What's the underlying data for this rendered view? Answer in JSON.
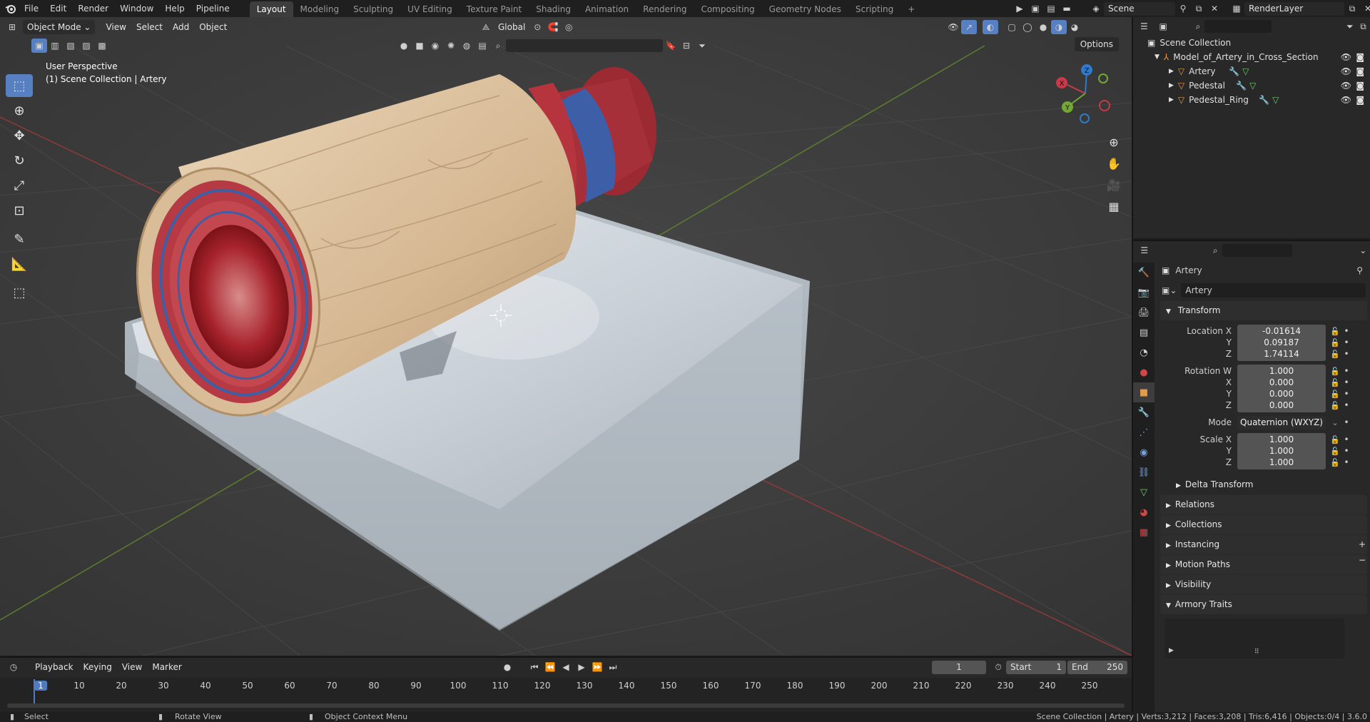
{
  "topbar": {
    "menus": [
      "File",
      "Edit",
      "Render",
      "Window",
      "Help",
      "Pipeline"
    ],
    "workspaces": [
      "Layout",
      "Modeling",
      "Sculpting",
      "UV Editing",
      "Texture Paint",
      "Shading",
      "Animation",
      "Rendering",
      "Compositing",
      "Geometry Nodes",
      "Scripting"
    ],
    "active_workspace": "Layout",
    "add_tab": "+",
    "scene": "Scene",
    "render_layer": "RenderLayer"
  },
  "viewport": {
    "mode": "Object Mode",
    "menus": [
      "View",
      "Select",
      "Add",
      "Object"
    ],
    "transform_orientation": "Global",
    "options": "Options",
    "info_line1": "User Perspective",
    "info_line2": "(1) Scene Collection | Artery",
    "gizmo": {
      "x": "X",
      "y": "Y",
      "z": "Z"
    }
  },
  "outliner": {
    "root": "Scene Collection",
    "collection": "Model_of_Artery_in_Cross_Section",
    "items": [
      {
        "label": "Artery"
      },
      {
        "label": "Pedestal"
      },
      {
        "label": "Pedestal_Ring"
      }
    ]
  },
  "properties": {
    "object_name": "Artery",
    "datablock_name": "Artery",
    "transform_title": "Transform",
    "location_label": "Location X",
    "location": {
      "x": "-0.01614",
      "y": "0.09187",
      "z": "1.74114"
    },
    "rotation_label": "Rotation W",
    "rotation": {
      "w": "1.000",
      "x": "0.000",
      "y": "0.000",
      "z": "0.000"
    },
    "mode_label": "Mode",
    "mode_value": "Quaternion (WXYZ)",
    "scale_label": "Scale X",
    "scale": {
      "x": "1.000",
      "y": "1.000",
      "z": "1.000"
    },
    "axis": {
      "x": "X",
      "y": "Y",
      "z": "Z"
    },
    "sections": [
      "Delta Transform",
      "Relations",
      "Collections",
      "Instancing",
      "Motion Paths",
      "Visibility",
      "Armory Traits"
    ]
  },
  "timeline": {
    "menus": [
      "Playback",
      "Keying",
      "View",
      "Marker"
    ],
    "current_frame": "1",
    "start_label": "Start",
    "start": "1",
    "end_label": "End",
    "end": "250",
    "ticks": [
      "1",
      "10",
      "20",
      "30",
      "40",
      "50",
      "60",
      "70",
      "80",
      "90",
      "100",
      "110",
      "120",
      "130",
      "140",
      "150",
      "160",
      "170",
      "180",
      "190",
      "200",
      "210",
      "220",
      "230",
      "240",
      "250"
    ]
  },
  "statusbar": {
    "select": "Select",
    "rotate": "Rotate View",
    "context": "Object Context Menu",
    "stats": "Scene Collection | Artery | Verts:3,212 | Faces:3,208 | Tris:6,416 | Objects:0/4 | 3.6.0"
  }
}
